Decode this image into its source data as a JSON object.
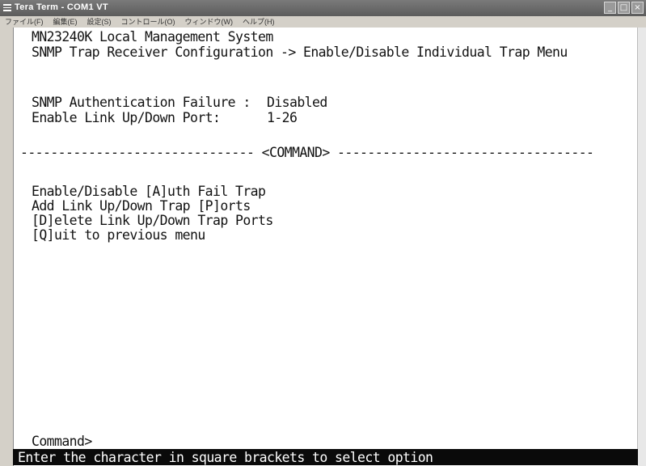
{
  "window": {
    "title": "Tera Term - COM1 VT",
    "controls": [
      "_",
      "□",
      "×"
    ]
  },
  "menubar": {
    "items": [
      "ファイル(F)",
      "編集(E)",
      "設定(S)",
      "コントロール(O)",
      "ウィンドウ(W)",
      "ヘルプ(H)"
    ]
  },
  "terminal": {
    "system_name": "MN23240K Local Management System",
    "breadcrumb": "SNMP Trap Receiver Configuration -> Enable/Disable Individual Trap Menu",
    "auth_failure_label": "SNMP Authentication Failure :",
    "auth_failure_value": "Disabled",
    "link_port_label": "Enable Link Up/Down Port:",
    "link_port_value": "1-26",
    "command_divider": "------------------------------- <COMMAND> ----------------------------------",
    "options": [
      "Enable/Disable [A]uth Fail Trap",
      "Add Link Up/Down Trap [P]orts",
      "[D]elete Link Up/Down Trap Ports",
      "[Q]uit to previous menu"
    ],
    "prompt": "Command>",
    "hint": "Enter the character in square brackets to select option"
  }
}
